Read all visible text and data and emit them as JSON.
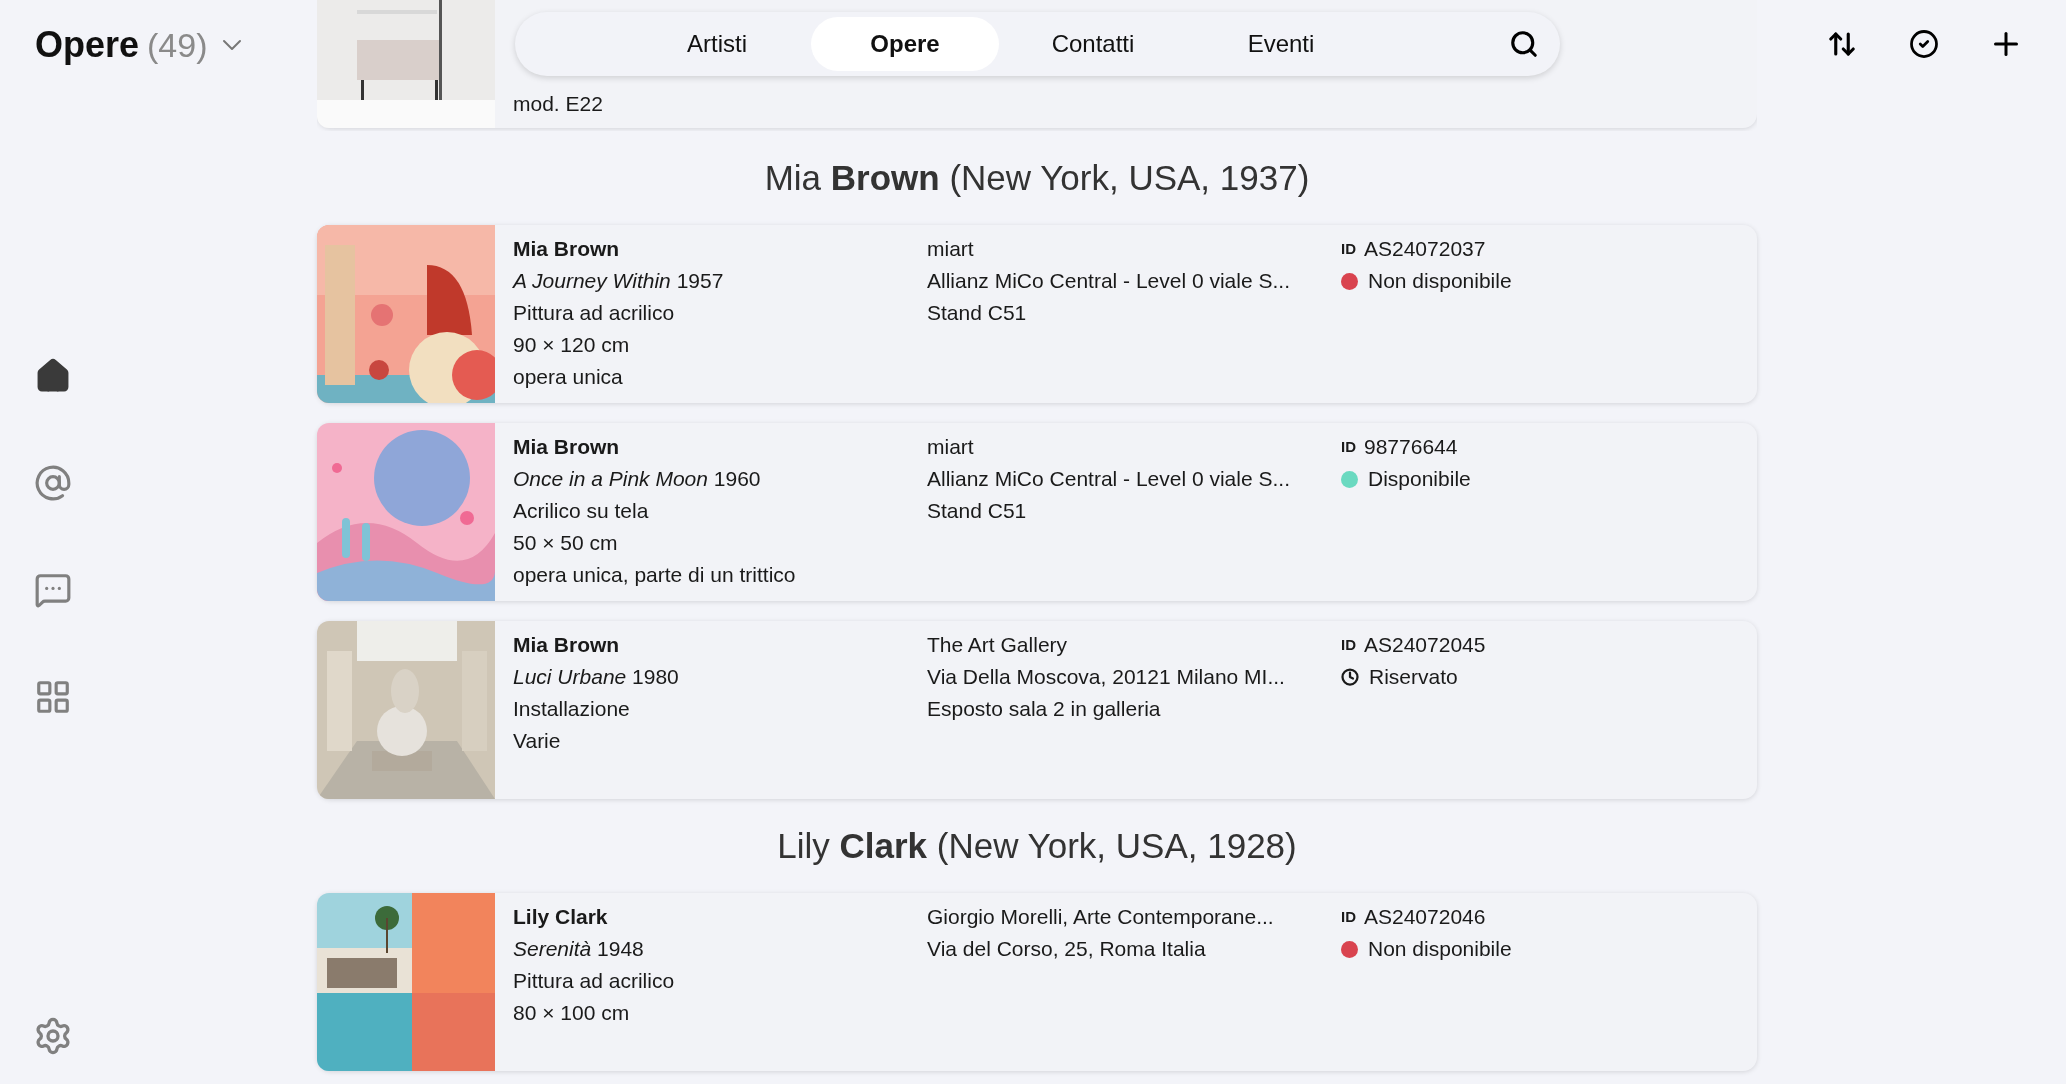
{
  "header": {
    "title": "Opere",
    "count": "(49)"
  },
  "tabs": [
    {
      "label": "Artisti",
      "selected": false
    },
    {
      "label": "Opere",
      "selected": true
    },
    {
      "label": "Contatti",
      "selected": false
    },
    {
      "label": "Eventi",
      "selected": false
    }
  ],
  "sidebar": {
    "items": [
      {
        "kind": "home",
        "selected": true
      },
      {
        "kind": "at",
        "selected": false
      },
      {
        "kind": "chat",
        "selected": false
      },
      {
        "kind": "apps",
        "selected": false
      }
    ]
  },
  "groups": [
    {
      "partial": true,
      "works": [
        {
          "image": {
            "kind": "picture"
          },
          "details": [
            "mod. E22"
          ]
        }
      ]
    },
    {
      "partial": false,
      "heading": "Mia **Brown** (New York, USA, 1937)",
      "works": [
        {
          "image": {
            "kind": "picture"
          },
          "artist": "Mia Brown",
          "title": "A Journey Within",
          "year": "1957",
          "details": [
            "Pittura ad acrilico",
            "90 × 120 cm",
            "opera unica"
          ],
          "location": [
            "miart",
            "Allianz MiCo Central - Level 0 viale S...",
            "Stand C51"
          ],
          "id_label": "ID",
          "id": "AS24072037",
          "status": {
            "kind": "dot",
            "color": "#d9434f",
            "label": "Non disponibile"
          }
        },
        {
          "image": {
            "kind": "picture"
          },
          "artist": "Mia Brown",
          "title": "Once in a Pink Moon",
          "year": "1960",
          "details": [
            "Acrilico su tela",
            "50 × 50 cm",
            "opera unica, parte di un trittico"
          ],
          "location": [
            "miart",
            "Allianz MiCo Central - Level 0 viale S...",
            "Stand C51"
          ],
          "id_label": "ID",
          "id": "98776644",
          "status": {
            "kind": "dot",
            "color": "#6ad9c0",
            "label": "Disponibile"
          }
        },
        {
          "image": {
            "kind": "picture"
          },
          "artist": "Mia Brown",
          "title": "Luci Urbane",
          "year": "1980",
          "details": [
            "Installazione",
            "Varie"
          ],
          "location": [
            "The Art Gallery",
            "Via Della Moscova, 20121 Milano MI...",
            "Esposto sala 2 in galleria"
          ],
          "id_label": "ID",
          "id": "AS24072045",
          "status": {
            "kind": "clock",
            "label": "Riservato"
          }
        }
      ]
    },
    {
      "partial": false,
      "heading": "Lily **Clark** (New York, USA, 1928)",
      "works": [
        {
          "image": {
            "kind": "picture"
          },
          "artist": "Lily Clark",
          "title": "Serenità",
          "year": "1948",
          "details": [
            "Pittura ad acrilico",
            "80 × 100 cm"
          ],
          "location": [
            "Giorgio Morelli, Arte Contemporane...",
            "Via del Corso, 25, Roma Italia"
          ],
          "id_label": "ID",
          "id": "AS24072046",
          "status": {
            "kind": "dot",
            "color": "#d9434f",
            "label": "Non disponibile"
          }
        }
      ]
    }
  ]
}
